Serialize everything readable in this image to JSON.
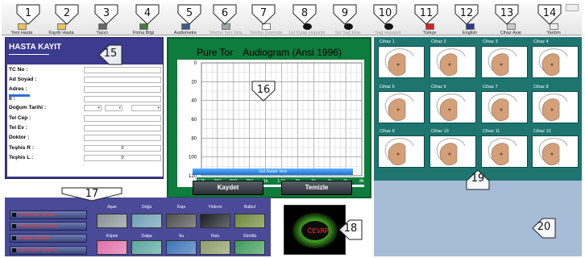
{
  "toolbar": {
    "buttons": [
      {
        "label": "Yeni Hasta",
        "icon": "folder-new-icon",
        "enabled": true
      },
      {
        "label": "Kayıtlı Hasta",
        "icon": "folder-open-icon",
        "enabled": true
      },
      {
        "label": "Yazıcı",
        "icon": "printer-icon",
        "enabled": true
      },
      {
        "label": "Firma Bilgi",
        "icon": "company-info-icon",
        "enabled": true
      },
      {
        "label": "Audiometre",
        "icon": "audiometer-icon",
        "enabled": true
      },
      {
        "label": "Telefon Veri Giriş",
        "icon": "phone-data-icon",
        "enabled": false
      },
      {
        "label": "Telefon Üzerinde",
        "icon": "document-icon",
        "enabled": false
      },
      {
        "label": "Sol Kulak Hoparlör",
        "icon": "speaker-left-icon",
        "enabled": false
      },
      {
        "label": "Sol Sağ Hop.",
        "icon": "speaker-both-icon",
        "enabled": false
      },
      {
        "label": "Sağ Hoparlör",
        "icon": "speaker-right-icon",
        "enabled": false
      },
      {
        "label": "Türkçe",
        "icon": "turkey-flag-icon",
        "enabled": true
      },
      {
        "label": "English",
        "icon": "uk-flag-icon",
        "enabled": true
      },
      {
        "label": "Cihaz Ayar",
        "icon": "settings-icon",
        "enabled": true
      },
      {
        "label": "Yardım",
        "icon": "help-icon",
        "enabled": true
      }
    ]
  },
  "callouts": [
    "1",
    "2",
    "3",
    "4",
    "5",
    "6",
    "7",
    "8",
    "9",
    "10",
    "11",
    "12",
    "13",
    "14",
    "15",
    "16",
    "17",
    "18",
    "19",
    "20"
  ],
  "patient": {
    "title": "HASTA KAYIT",
    "fields": [
      {
        "label": "TC No :",
        "value": ""
      },
      {
        "label": "Ad Soyad :",
        "value": ""
      },
      {
        "label": "Adres :",
        "value": ""
      },
      {
        "label": "İl :",
        "value": ""
      },
      {
        "label": "Doğum Tarihi :",
        "value": ""
      },
      {
        "label": "Tel Cep :",
        "value": ""
      },
      {
        "label": "Tel Ev :",
        "value": ""
      },
      {
        "label": "Doktor :",
        "value": ""
      },
      {
        "label": "Teşhis R :",
        "value": "0"
      },
      {
        "label": "Teşhis L :",
        "value": "0"
      }
    ]
  },
  "audiogram": {
    "title_left": "Pure Tor",
    "title_right": "Audiogram (Ansi 1996)",
    "test_bar_label": "Sol Kulak Test",
    "save_label": "Kaydet",
    "clear_label": "Temizle"
  },
  "chart_data": {
    "type": "line",
    "title": "Audiogram (Ansi 1996)",
    "x": [
      "125",
      "250",
      "500",
      "750",
      "1k",
      "1.5k",
      "2k",
      "3k",
      "4k",
      "6k",
      "8k"
    ],
    "ylim": [
      0,
      120
    ],
    "y_ticks": [
      "0",
      "20",
      "40",
      "60",
      "80",
      "100",
      "120"
    ],
    "y_inverted": true,
    "grid": true,
    "series": []
  },
  "devices": [
    {
      "label": "Cihaz 1"
    },
    {
      "label": "Cihaz 2"
    },
    {
      "label": "Cihaz 3"
    },
    {
      "label": "Cihaz 4"
    },
    {
      "label": "Cihaz 5"
    },
    {
      "label": "Cihaz 6"
    },
    {
      "label": "Cihaz 7"
    },
    {
      "label": "Cihaz 8"
    },
    {
      "label": "Cihaz 9"
    },
    {
      "label": "Cihaz 10"
    },
    {
      "label": "Cihaz 11"
    },
    {
      "label": "Cihaz 12"
    }
  ],
  "sounds": {
    "categories": [
      "Çevresel Sesler",
      "Restorant sesleri",
      "Araba Sesleri",
      "Özel Ses Seçimi"
    ],
    "row1": [
      {
        "label": "Aşan",
        "color": "#8a9296"
      },
      {
        "label": "Doğa",
        "color": "#6f9fb8"
      },
      {
        "label": "Kapı",
        "color": "#4f4f4f"
      },
      {
        "label": "Yıldırım",
        "color": "#1d1d26"
      },
      {
        "label": "Bulbul",
        "color": "#6e8a3a"
      }
    ],
    "row2": [
      {
        "label": "Köpek",
        "color": "#e06fa8"
      },
      {
        "label": "Dalga",
        "color": "#5aa7a0"
      },
      {
        "label": "Su",
        "color": "#3a73b8"
      },
      {
        "label": "Dolu",
        "color": "#8d9e6a"
      },
      {
        "label": "Gürültü",
        "color": "#3f9a5b"
      }
    ]
  },
  "cevap": {
    "label": "CEVAP"
  }
}
